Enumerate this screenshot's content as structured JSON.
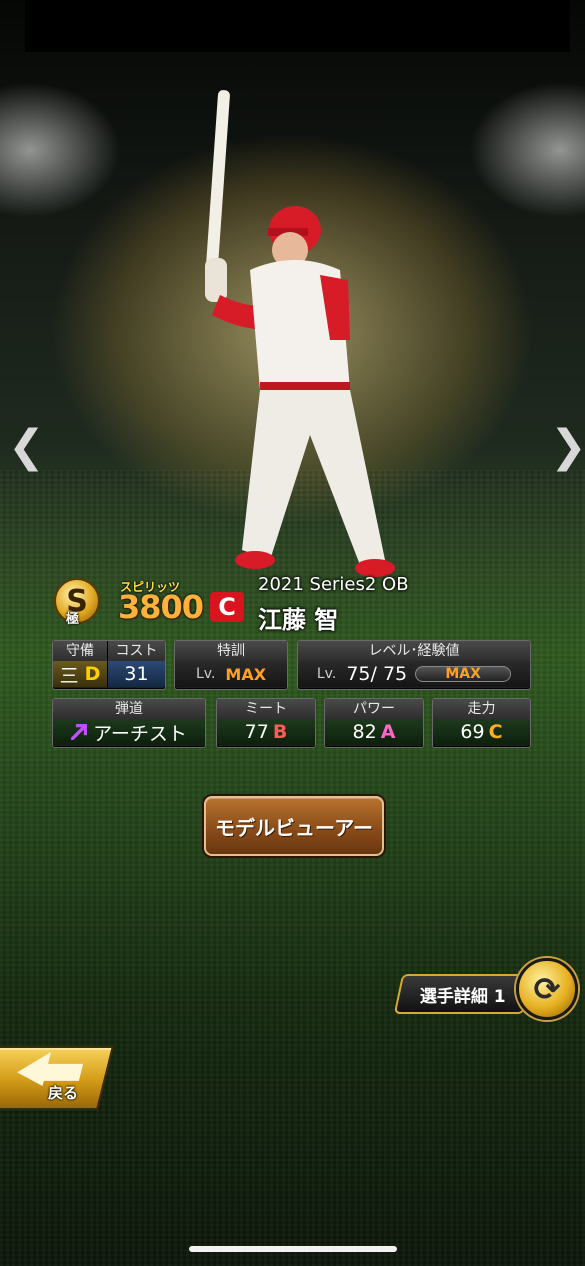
{
  "nav": {
    "prev_icon": "chevron-left-icon",
    "prev": "❮",
    "next_icon": "chevron-right-icon",
    "next": "❯"
  },
  "card": {
    "rank_letter": "S",
    "rank_sub": "極",
    "spirits_label": "スピリッツ",
    "spirits_value": "3800",
    "team_logo": "C",
    "series": "2021 Series2 OB",
    "name": "江藤 智"
  },
  "stats": {
    "position_label": "守備",
    "position_value": "三",
    "position_grade": "D",
    "cost_label": "コスト",
    "cost_value": "31",
    "training_label": "特訓",
    "training_lv": "Lv.",
    "training_value": "MAX",
    "level_label": "レベル･経験値",
    "level_lv": "Lv.",
    "level_value": "75/ 75",
    "level_exp": "MAX",
    "trajectory_label": "弾道",
    "trajectory_value": "アーチスト",
    "meet_label": "ミート",
    "meet_value": "77",
    "meet_grade": "B",
    "power_label": "パワー",
    "power_value": "82",
    "power_grade": "A",
    "speed_label": "走力",
    "speed_value": "69",
    "speed_grade": "C"
  },
  "buttons": {
    "model_viewer": "モデルビューアー",
    "player_detail": "選手詳細 1",
    "back": "戻る"
  },
  "colors": {
    "accent_gold": "#d9a830",
    "max_orange": "#ffa020",
    "team_red": "#d8141e"
  }
}
